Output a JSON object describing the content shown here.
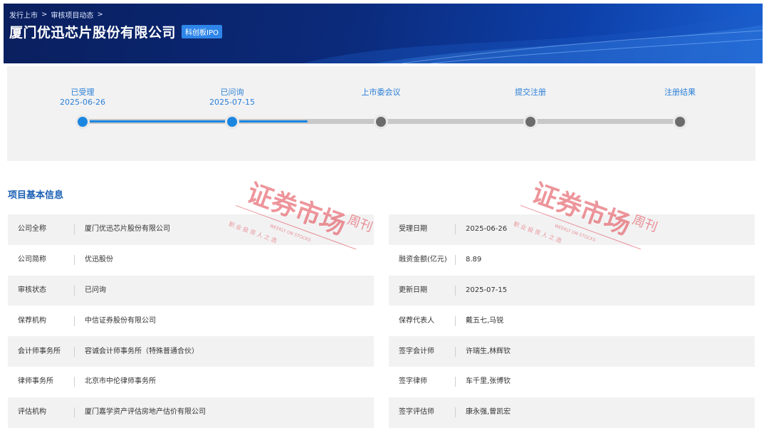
{
  "breadcrumb": [
    "发行上市",
    "审核项目动态"
  ],
  "header": {
    "title": "厦门优迅芯片股份有限公司",
    "badge": "科创板IPO"
  },
  "progress": {
    "steps": [
      {
        "label": "已受理",
        "date": "2025-06-26",
        "status": "done"
      },
      {
        "label": "已问询",
        "date": "2025-07-15",
        "status": "done"
      },
      {
        "label": "上市委会议",
        "date": "",
        "status": "pending"
      },
      {
        "label": "提交注册",
        "date": "",
        "status": "pending"
      },
      {
        "label": "注册结果",
        "date": "",
        "status": "pending"
      }
    ],
    "active_color": "#1a86e0",
    "pending_color": "#6b6b6b"
  },
  "section": {
    "title": "项目基本信息"
  },
  "info_left": [
    {
      "label": "公司全称",
      "value": "厦门优迅芯片股份有限公司"
    },
    {
      "label": "公司简称",
      "value": "优迅股份"
    },
    {
      "label": "审核状态",
      "value": "已问询"
    },
    {
      "label": "保荐机构",
      "value": "中信证券股份有限公司"
    },
    {
      "label": "会计师事务所",
      "value": "容诚会计师事务所（特殊普通合伙）"
    },
    {
      "label": "律师事务所",
      "value": "北京市中伦律师事务所"
    },
    {
      "label": "评估机构",
      "value": "厦门嘉学资产评估房地产估价有限公司"
    }
  ],
  "info_right": [
    {
      "label": "受理日期",
      "value": "2025-06-26"
    },
    {
      "label": "融资金额(亿元)",
      "value": "8.89"
    },
    {
      "label": "更新日期",
      "value": "2025-07-15"
    },
    {
      "label": "保荐代表人",
      "value": "戴五七,马锐"
    },
    {
      "label": "签字会计师",
      "value": "许瑞生,林辉钦"
    },
    {
      "label": "签字律师",
      "value": "车千里,张博钦"
    },
    {
      "label": "签字评估师",
      "value": "康永强,曾凯宏"
    }
  ],
  "watermark": {
    "main": "证券市场",
    "side": "周刊",
    "sub": "WEEKLY ON STOCKS",
    "slogan": "职 业 投 资 人 之 选",
    "color": "#e0404a"
  }
}
